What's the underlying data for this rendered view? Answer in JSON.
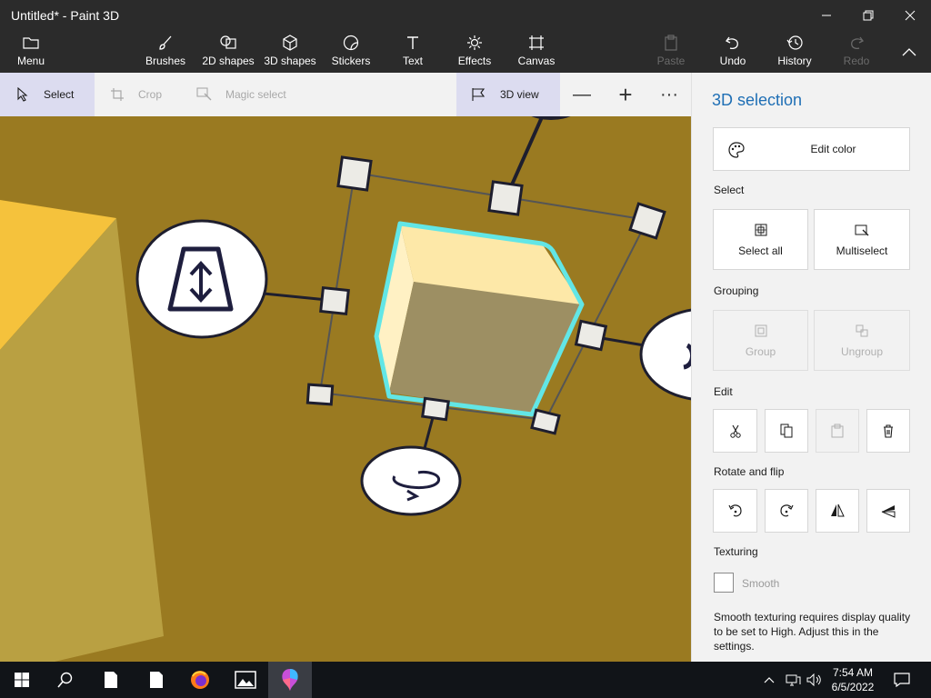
{
  "window": {
    "title": "Untitled* - Paint 3D"
  },
  "ribbon": {
    "menu": "Menu",
    "brushes": "Brushes",
    "shapes2d": "2D shapes",
    "shapes3d": "3D shapes",
    "stickers": "Stickers",
    "text": "Text",
    "effects": "Effects",
    "canvas": "Canvas",
    "paste": "Paste",
    "undo": "Undo",
    "history": "History",
    "redo": "Redo"
  },
  "toolbar": {
    "select": "Select",
    "crop": "Crop",
    "magic_select": "Magic select",
    "view3d": "3D view",
    "zoom_out": "—",
    "zoom_in": "+",
    "more": "···"
  },
  "panel": {
    "title": "3D selection",
    "edit_color": "Edit color",
    "select_heading": "Select",
    "select_all": "Select all",
    "multiselect": "Multiselect",
    "grouping_heading": "Grouping",
    "group": "Group",
    "ungroup": "Ungroup",
    "edit_heading": "Edit",
    "rotate_heading": "Rotate and flip",
    "texturing_heading": "Texturing",
    "smooth": "Smooth",
    "texture_note": "Smooth texturing requires display quality to be set to High. Adjust this in the settings."
  },
  "taskbar": {
    "time": "7:54 AM",
    "date": "6/5/2022"
  },
  "colors": {
    "chrome": "#2b2b2b",
    "canvas": "#9a7a21",
    "selection_outline": "#62e6e6",
    "accent_title": "#1f6fb5"
  }
}
